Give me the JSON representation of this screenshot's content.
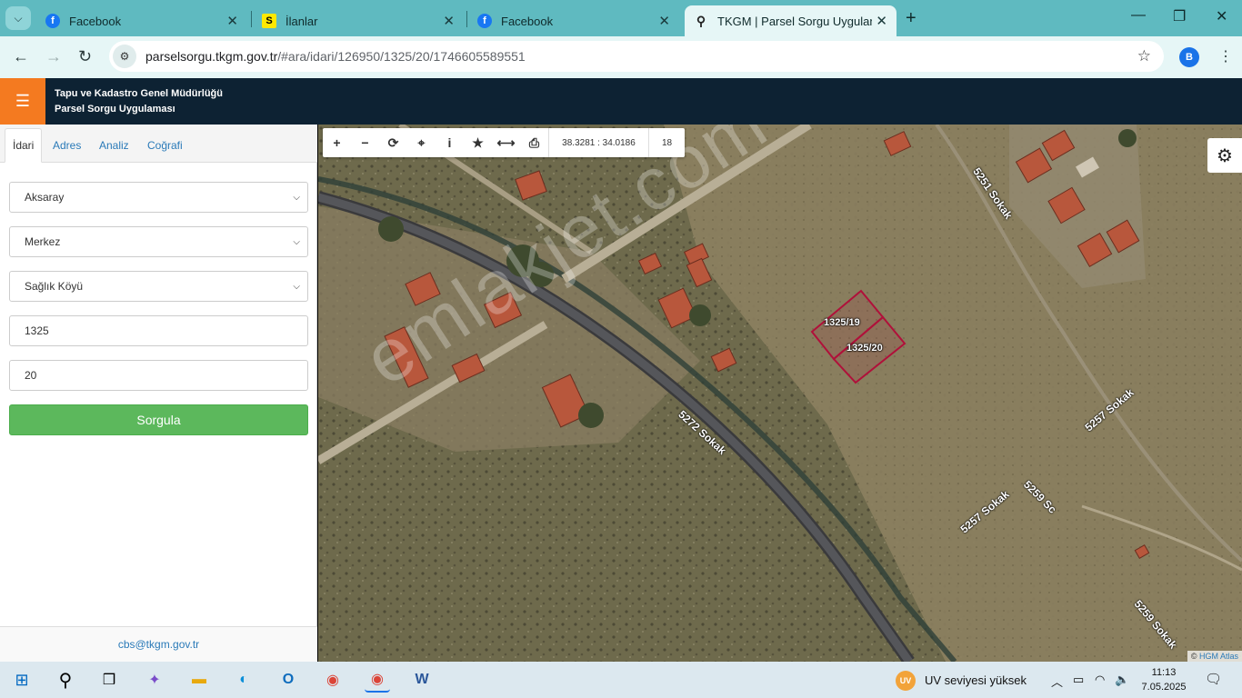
{
  "browser": {
    "tabs": [
      {
        "label": "Facebook",
        "icon": "facebook-icon"
      },
      {
        "label": "İlanlar",
        "icon": "sahibinden-icon"
      },
      {
        "label": "Facebook",
        "icon": "facebook-icon"
      },
      {
        "label": "TKGM | Parsel Sorgu Uygulamas",
        "icon": "location-pin-icon",
        "active": true
      }
    ],
    "url_host": "parselsorgu.tkgm.gov.tr",
    "url_path": "/#ara/idari/126950/1325/20/1746605589551",
    "profile_initial": "B"
  },
  "app": {
    "title_line1": "Tapu ve Kadastro Genel Müdürlüğü",
    "title_line2": "Parsel Sorgu Uygulaması"
  },
  "panel": {
    "tabs": [
      "İdari",
      "Adres",
      "Analiz",
      "Coğrafi"
    ],
    "active_tab": "İdari",
    "il": "Aksaray",
    "ilce": "Merkez",
    "mahalle": "Sağlık Köyü",
    "ada": "1325",
    "parsel": "20",
    "submit_label": "Sorgula",
    "footer_email": "cbs@tkgm.gov.tr"
  },
  "map": {
    "coords": "38.3281 : 34.0186",
    "zoom": "18",
    "watermark": "emlakjet.com",
    "attribution_prefix": "©",
    "attribution_link": "HGM Atlas",
    "parcels": [
      "1325/19",
      "1325/20"
    ],
    "streets": {
      "s5272": "5272 Sokak",
      "s5251": "5251 Sokak",
      "s5257a": "5257 Sokak",
      "s5257b": "5257 Sokak",
      "s5259a": "5259 Sc",
      "s5259b": "5259 Sokak"
    },
    "colors": {
      "parcel_outline": "#b0103a",
      "query_button": "#5cb85c",
      "menu_accent": "#f47a20"
    }
  },
  "taskbar": {
    "weather_badge": "UV",
    "weather_text": "UV seviyesi yüksek",
    "time": "11:13",
    "date": "7.05.2025"
  }
}
